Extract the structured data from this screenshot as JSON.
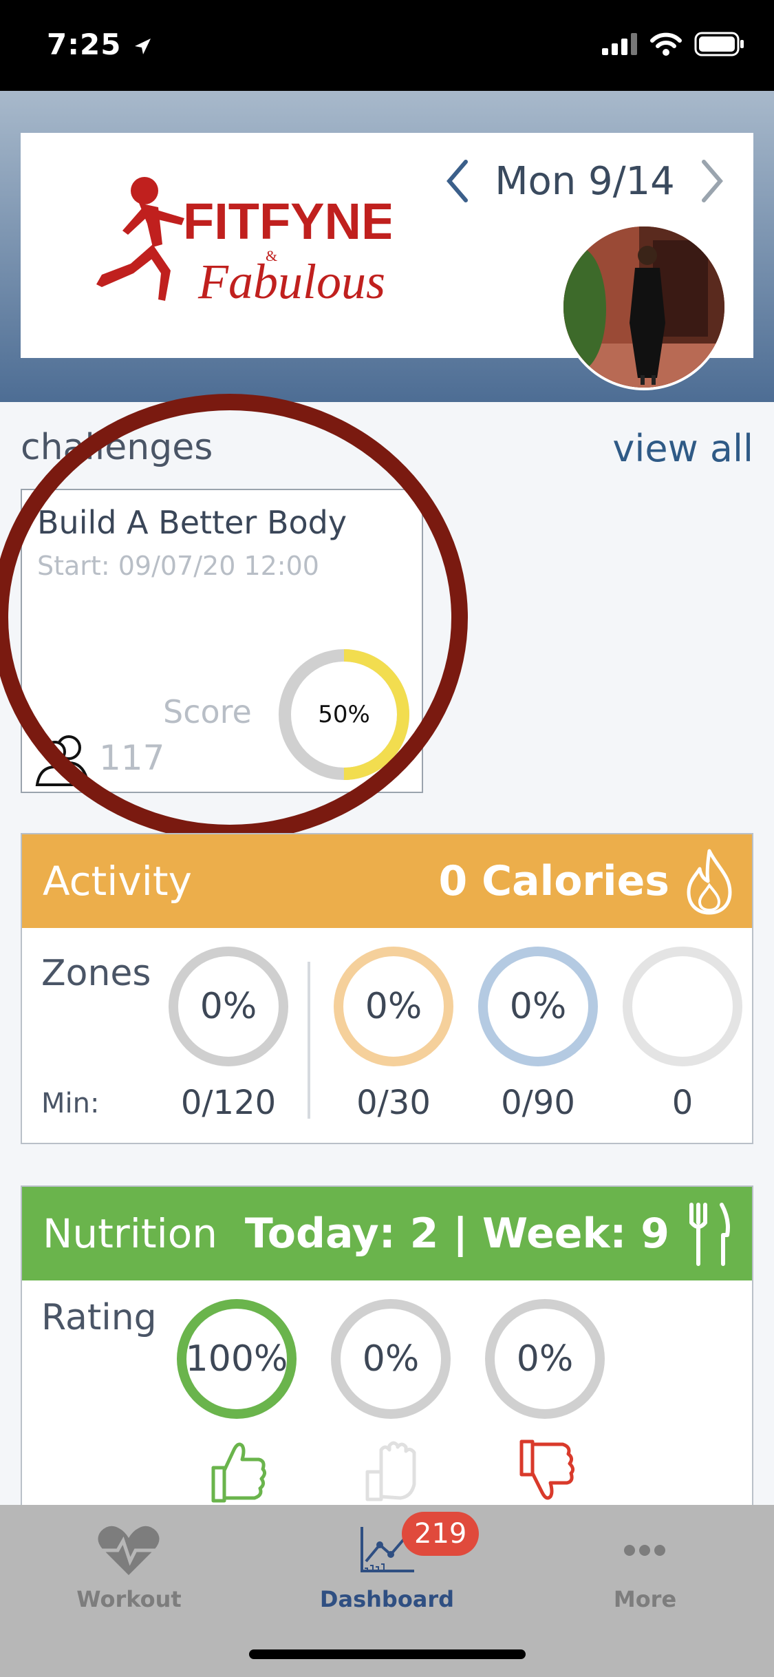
{
  "status_bar": {
    "time": "7:25"
  },
  "header": {
    "date": "Mon 9/14",
    "logo": {
      "brand_top": "FITFYNE",
      "brand_and": "&",
      "brand_bottom": "Fabulous"
    }
  },
  "challenges": {
    "title": "challenges",
    "view_all": "view all",
    "card": {
      "name": "Build A Better Body",
      "start": "Start: 09/07/20 12:00",
      "score_label": "Score",
      "score_value": "50%",
      "score_fraction": 0.5,
      "members": "117"
    }
  },
  "activity": {
    "title": "Activity",
    "calories": "0 Calories",
    "zones_label": "Zones",
    "min_label": "Min:",
    "zones": [
      {
        "percent": "0%",
        "minutes": "0/120",
        "color": "#cfcfcf"
      },
      {
        "percent": "0%",
        "minutes": "0/30",
        "color": "#f5d09b"
      },
      {
        "percent": "0%",
        "minutes": "0/90",
        "color": "#b4cae2"
      },
      {
        "percent": "",
        "minutes": "0",
        "color": "#e4e4e4"
      }
    ]
  },
  "nutrition": {
    "title": "Nutrition",
    "summary": "Today: 2 | Week: 9",
    "rating_label": "Rating",
    "ratings": [
      {
        "percent": "100%",
        "color": "#6ab44c",
        "icon": "thumbs-up-icon"
      },
      {
        "percent": "0%",
        "color": "#d0d0d0",
        "icon": "thumbs-neutral-icon"
      },
      {
        "percent": "0%",
        "color": "#d0d0d0",
        "icon": "thumbs-down-icon"
      }
    ]
  },
  "tabs": [
    {
      "label": "Workout",
      "icon": "heart-pulse-icon",
      "active": false
    },
    {
      "label": "Dashboard",
      "icon": "chart-icon",
      "active": true,
      "badge": "219"
    },
    {
      "label": "More",
      "icon": "more-dots-icon",
      "active": false
    }
  ],
  "colors": {
    "activity": "#ecae4b",
    "nutrition": "#6ab44c",
    "score_ring": "#f2dd4f",
    "tab_active": "#2f4f82",
    "tab_inactive": "#7d7d7d",
    "annotation": "#7a1a10"
  }
}
